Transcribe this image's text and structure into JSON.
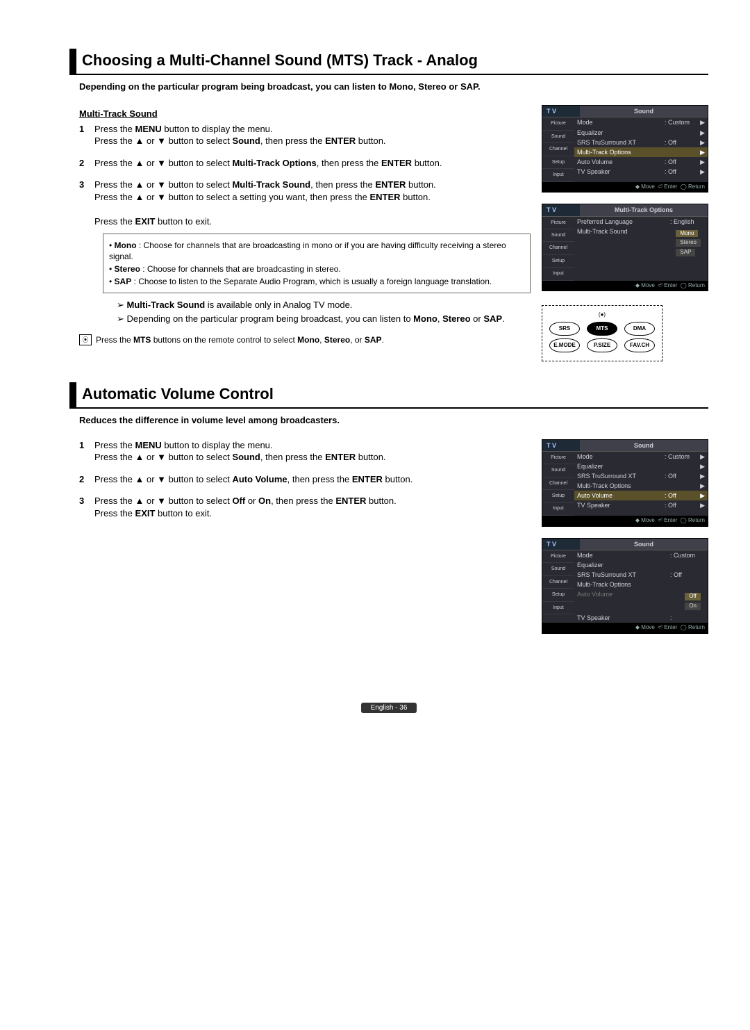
{
  "section1": {
    "title": "Choosing a Multi-Channel Sound (MTS) Track - Analog",
    "intro": "Depending on the particular program being broadcast, you can listen to Mono, Stereo or SAP.",
    "subhead": "Multi-Track Sound",
    "step1a": "Press the ",
    "step1a_bold": "MENU",
    "step1a2": " button to display the menu.",
    "step1b": "Press the ▲ or ▼ button to select ",
    "step1b_bold": "Sound",
    "step1b2": ", then press the ",
    "step1b_bold2": "ENTER",
    "step1b3": " button.",
    "step2a": "Press the ▲ or ▼ button to select ",
    "step2a_bold": "Multi-Track Options",
    "step2a2": ", then press the ",
    "step2a_bold2": "ENTER",
    "step2a3": " button.",
    "step3a": "Press the ▲ or ▼ button to select ",
    "step3a_bold": "Multi-Track Sound",
    "step3a2": ", then press the ",
    "step3a_bold2": "ENTER",
    "step3a3": " button.",
    "step3b": "Press the ▲ or ▼ button to select a setting you want, then press the ",
    "step3b_bold": "ENTER",
    "step3b2": " button.",
    "step3c": "Press the ",
    "step3c_bold": "EXIT",
    "step3c2": " button to exit.",
    "bullet_mono_l": "Mono",
    "bullet_mono": " : Choose for channels that are broadcasting in mono or if you are having difficulty receiving a stereo signal.",
    "bullet_stereo_l": "Stereo",
    "bullet_stereo": " : Choose for channels that are broadcasting in stereo.",
    "bullet_sap_l": "SAP",
    "bullet_sap": " : Choose to listen to the Separate Audio Program, which is usually a foreign language translation.",
    "note1_bold": "Multi-Track Sound",
    "note1": " is available only in Analog TV mode.",
    "note2a": "Depending on the particular program being broadcast, you can listen to ",
    "note2b": "Mono",
    "note2c": ", ",
    "note2d": "Stereo",
    "note2e": " or ",
    "note2f": "SAP",
    "note2g": ".",
    "tip_a": "Press the ",
    "tip_b": "MTS",
    "tip_c": " buttons on the remote control to select ",
    "tip_d": "Mono",
    "tip_e": ", ",
    "tip_f": "Stereo",
    "tip_g": ", or ",
    "tip_h": "SAP",
    "tip_i": "."
  },
  "section2": {
    "title": "Automatic Volume Control",
    "intro": "Reduces the difference in volume level among broadcasters.",
    "step1a": "Press the ",
    "step1a_bold": "MENU",
    "step1a2": " button to display the menu.",
    "step1b": "Press the ▲ or ▼ button to select ",
    "step1b_bold": "Sound",
    "step1b2": ", then press the ",
    "step1b_bold2": "ENTER",
    "step1b3": " button.",
    "step2a": "Press the ▲ or ▼ button to select ",
    "step2a_bold": "Auto Volume",
    "step2a2": ", then press the ",
    "step2a_bold2": "ENTER",
    "step2a3": " button.",
    "step3a": "Press the ▲ or ▼ button to select ",
    "step3a_bold": "Off",
    "step3a_mid": " or ",
    "step3a_bold2": "On",
    "step3a2": ", then press the ",
    "step3a_bold3": "ENTER",
    "step3a3": " button.",
    "step3b": "Press the ",
    "step3b_bold": "EXIT",
    "step3b2": " button to exit."
  },
  "osd": {
    "tv": "T V",
    "sound_title": "Sound",
    "mto_title": "Multi-Track Options",
    "tabs": {
      "picture": "Picture",
      "sound": "Sound",
      "channel": "Channel",
      "setup": "Setup",
      "input": "Input"
    },
    "rows": {
      "mode": "Mode",
      "mode_v": ": Custom",
      "eq": "Equalizer",
      "srs": "SRS TruSurround XT",
      "srs_v": ": Off",
      "mto": "Multi-Track Options",
      "av": "Auto Volume",
      "av_v": ": Off",
      "tvspk": "TV Speaker",
      "tvspk_v": ": Off",
      "pref": "Preferred Language",
      "pref_v": ": English",
      "mts": "Multi-Track Sound"
    },
    "opts": {
      "mono": "Mono",
      "stereo": "Stereo",
      "sap": "SAP",
      "off": "Off",
      "on": "On"
    },
    "foot": {
      "move": "Move",
      "enter": "Enter",
      "return": "Return"
    }
  },
  "remote": {
    "srs": "SRS",
    "mts": "MTS",
    "dma": "DMA",
    "emode": "E.MODE",
    "psize": "P.SIZE",
    "favch": "FAV.CH"
  },
  "footer": "English - 36"
}
